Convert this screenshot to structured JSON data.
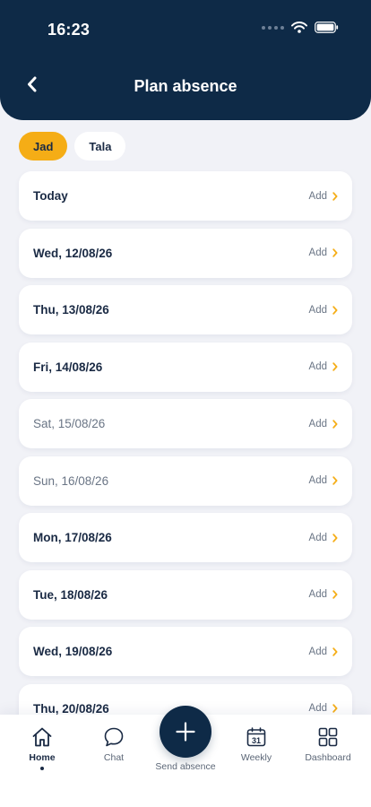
{
  "status_bar": {
    "time": "16:23"
  },
  "header": {
    "title": "Plan absence"
  },
  "colors": {
    "header_bg": "#0e2a47",
    "accent": "#f5ad16",
    "chevron": "#f5ad16"
  },
  "chips": [
    {
      "label": "Jad",
      "active": true
    },
    {
      "label": "Tala",
      "active": false
    }
  ],
  "days": [
    {
      "label": "Today",
      "action": "Add",
      "muted": false
    },
    {
      "label": "Wed, 12/08/26",
      "action": "Add",
      "muted": false
    },
    {
      "label": "Thu, 13/08/26",
      "action": "Add",
      "muted": false
    },
    {
      "label": "Fri, 14/08/26",
      "action": "Add",
      "muted": false
    },
    {
      "label": "Sat, 15/08/26",
      "action": "Add",
      "muted": true
    },
    {
      "label": "Sun, 16/08/26",
      "action": "Add",
      "muted": true
    },
    {
      "label": "Mon, 17/08/26",
      "action": "Add",
      "muted": false
    },
    {
      "label": "Tue, 18/08/26",
      "action": "Add",
      "muted": false
    },
    {
      "label": "Wed, 19/08/26",
      "action": "Add",
      "muted": false
    },
    {
      "label": "Thu, 20/08/26",
      "action": "Add",
      "muted": false
    }
  ],
  "tabbar": {
    "home": "Home",
    "chat": "Chat",
    "send_absence": "Send absence",
    "weekly": "Weekly",
    "weekly_calendar_day": "31",
    "dashboard": "Dashboard"
  }
}
